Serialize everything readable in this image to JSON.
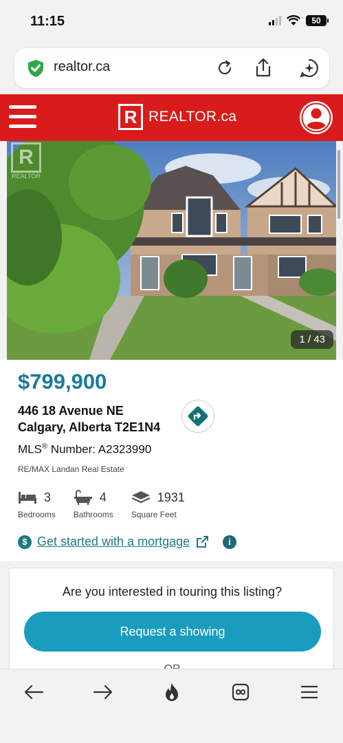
{
  "status": {
    "time": "11:15",
    "battery": "50"
  },
  "browser": {
    "url": "realtor.ca"
  },
  "header": {
    "logo_letter": "R",
    "logo_text": "REALTOR.ca"
  },
  "photo": {
    "watermark": "REALTOR",
    "counter": "1 / 43"
  },
  "listing": {
    "price": "$799,900",
    "address_line1": "446 18 Avenue NE",
    "address_line2": "Calgary, Alberta T2E1N4",
    "mls_prefix": "MLS",
    "mls_registered": "®",
    "mls_suffix": " Number: A2323990",
    "brokerage": "RE/MAX Landan Real Estate",
    "bedrooms": {
      "value": "3",
      "label": "Bedrooms"
    },
    "bathrooms": {
      "value": "4",
      "label": "Bathrooms"
    },
    "square_feet": {
      "value": "1931",
      "label": "Square Feet"
    },
    "mortgage_link": "Get started with a mortgage",
    "dollar_symbol": "$",
    "info_symbol": "i"
  },
  "tour": {
    "question": "Are you interested in touring this listing?",
    "button": "Request a showing",
    "or": "OR"
  },
  "icons": {
    "shield": "shield-check-icon",
    "reload": "reload-icon",
    "share": "share-icon",
    "assistant": "assistant-icon",
    "menu": "hamburger-icon",
    "account": "account-icon",
    "directions": "directions-icon",
    "bed": "bed-icon",
    "bath": "bath-icon",
    "area": "area-icon",
    "back": "back-arrow-icon",
    "forward": "forward-arrow-icon",
    "fire": "fire-icon",
    "tabs": "tabs-icon",
    "more": "menu-icon"
  },
  "colors": {
    "brand_red": "#d91b1b",
    "price_blue": "#1b7a98",
    "teal": "#1a7a80",
    "button": "#1a9cbf"
  }
}
